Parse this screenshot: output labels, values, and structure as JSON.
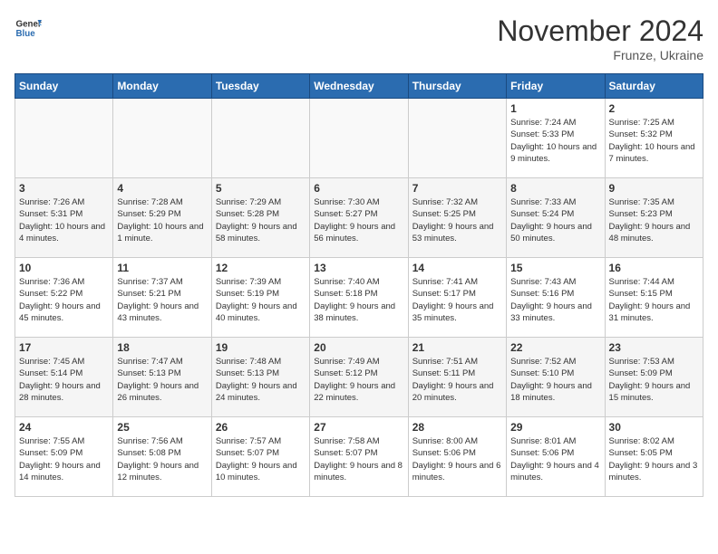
{
  "header": {
    "logo_line1": "General",
    "logo_line2": "Blue",
    "month": "November 2024",
    "location": "Frunze, Ukraine"
  },
  "weekdays": [
    "Sunday",
    "Monday",
    "Tuesday",
    "Wednesday",
    "Thursday",
    "Friday",
    "Saturday"
  ],
  "weeks": [
    [
      {
        "day": "",
        "info": ""
      },
      {
        "day": "",
        "info": ""
      },
      {
        "day": "",
        "info": ""
      },
      {
        "day": "",
        "info": ""
      },
      {
        "day": "",
        "info": ""
      },
      {
        "day": "1",
        "info": "Sunrise: 7:24 AM\nSunset: 5:33 PM\nDaylight: 10 hours and 9 minutes."
      },
      {
        "day": "2",
        "info": "Sunrise: 7:25 AM\nSunset: 5:32 PM\nDaylight: 10 hours and 7 minutes."
      }
    ],
    [
      {
        "day": "3",
        "info": "Sunrise: 7:26 AM\nSunset: 5:31 PM\nDaylight: 10 hours and 4 minutes."
      },
      {
        "day": "4",
        "info": "Sunrise: 7:28 AM\nSunset: 5:29 PM\nDaylight: 10 hours and 1 minute."
      },
      {
        "day": "5",
        "info": "Sunrise: 7:29 AM\nSunset: 5:28 PM\nDaylight: 9 hours and 58 minutes."
      },
      {
        "day": "6",
        "info": "Sunrise: 7:30 AM\nSunset: 5:27 PM\nDaylight: 9 hours and 56 minutes."
      },
      {
        "day": "7",
        "info": "Sunrise: 7:32 AM\nSunset: 5:25 PM\nDaylight: 9 hours and 53 minutes."
      },
      {
        "day": "8",
        "info": "Sunrise: 7:33 AM\nSunset: 5:24 PM\nDaylight: 9 hours and 50 minutes."
      },
      {
        "day": "9",
        "info": "Sunrise: 7:35 AM\nSunset: 5:23 PM\nDaylight: 9 hours and 48 minutes."
      }
    ],
    [
      {
        "day": "10",
        "info": "Sunrise: 7:36 AM\nSunset: 5:22 PM\nDaylight: 9 hours and 45 minutes."
      },
      {
        "day": "11",
        "info": "Sunrise: 7:37 AM\nSunset: 5:21 PM\nDaylight: 9 hours and 43 minutes."
      },
      {
        "day": "12",
        "info": "Sunrise: 7:39 AM\nSunset: 5:19 PM\nDaylight: 9 hours and 40 minutes."
      },
      {
        "day": "13",
        "info": "Sunrise: 7:40 AM\nSunset: 5:18 PM\nDaylight: 9 hours and 38 minutes."
      },
      {
        "day": "14",
        "info": "Sunrise: 7:41 AM\nSunset: 5:17 PM\nDaylight: 9 hours and 35 minutes."
      },
      {
        "day": "15",
        "info": "Sunrise: 7:43 AM\nSunset: 5:16 PM\nDaylight: 9 hours and 33 minutes."
      },
      {
        "day": "16",
        "info": "Sunrise: 7:44 AM\nSunset: 5:15 PM\nDaylight: 9 hours and 31 minutes."
      }
    ],
    [
      {
        "day": "17",
        "info": "Sunrise: 7:45 AM\nSunset: 5:14 PM\nDaylight: 9 hours and 28 minutes."
      },
      {
        "day": "18",
        "info": "Sunrise: 7:47 AM\nSunset: 5:13 PM\nDaylight: 9 hours and 26 minutes."
      },
      {
        "day": "19",
        "info": "Sunrise: 7:48 AM\nSunset: 5:13 PM\nDaylight: 9 hours and 24 minutes."
      },
      {
        "day": "20",
        "info": "Sunrise: 7:49 AM\nSunset: 5:12 PM\nDaylight: 9 hours and 22 minutes."
      },
      {
        "day": "21",
        "info": "Sunrise: 7:51 AM\nSunset: 5:11 PM\nDaylight: 9 hours and 20 minutes."
      },
      {
        "day": "22",
        "info": "Sunrise: 7:52 AM\nSunset: 5:10 PM\nDaylight: 9 hours and 18 minutes."
      },
      {
        "day": "23",
        "info": "Sunrise: 7:53 AM\nSunset: 5:09 PM\nDaylight: 9 hours and 15 minutes."
      }
    ],
    [
      {
        "day": "24",
        "info": "Sunrise: 7:55 AM\nSunset: 5:09 PM\nDaylight: 9 hours and 14 minutes."
      },
      {
        "day": "25",
        "info": "Sunrise: 7:56 AM\nSunset: 5:08 PM\nDaylight: 9 hours and 12 minutes."
      },
      {
        "day": "26",
        "info": "Sunrise: 7:57 AM\nSunset: 5:07 PM\nDaylight: 9 hours and 10 minutes."
      },
      {
        "day": "27",
        "info": "Sunrise: 7:58 AM\nSunset: 5:07 PM\nDaylight: 9 hours and 8 minutes."
      },
      {
        "day": "28",
        "info": "Sunrise: 8:00 AM\nSunset: 5:06 PM\nDaylight: 9 hours and 6 minutes."
      },
      {
        "day": "29",
        "info": "Sunrise: 8:01 AM\nSunset: 5:06 PM\nDaylight: 9 hours and 4 minutes."
      },
      {
        "day": "30",
        "info": "Sunrise: 8:02 AM\nSunset: 5:05 PM\nDaylight: 9 hours and 3 minutes."
      }
    ]
  ]
}
